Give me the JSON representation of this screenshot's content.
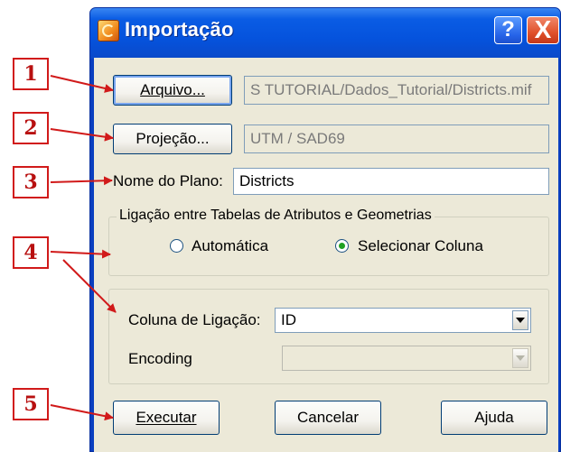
{
  "window": {
    "title": "Importação",
    "help_label": "?",
    "close_label": "X"
  },
  "arquivo": {
    "button_label": "Arquivo...",
    "path_value": "S TUTORIAL/Dados_Tutorial/Districts.mif"
  },
  "projecao": {
    "button_label": "Projeção...",
    "value": "UTM / SAD69"
  },
  "plano": {
    "label": "Nome do Plano:",
    "value": "Districts"
  },
  "ligacao": {
    "legend": "Ligação entre Tabelas de Atributos e Geometrias",
    "options": [
      {
        "label": "Automática",
        "checked": false
      },
      {
        "label": "Selecionar Coluna",
        "checked": true
      }
    ]
  },
  "coluna": {
    "label": "Coluna de Ligação:",
    "value": "ID"
  },
  "encoding": {
    "label": "Encoding",
    "value": ""
  },
  "actions": {
    "executar": "Executar",
    "cancelar": "Cancelar",
    "ajuda": "Ajuda"
  },
  "callouts": [
    "1",
    "2",
    "3",
    "4",
    "5"
  ],
  "colors": {
    "titlebar": "#0553dd",
    "dialog_bg": "#ece9d8",
    "callout_red": "#d11a1a"
  }
}
